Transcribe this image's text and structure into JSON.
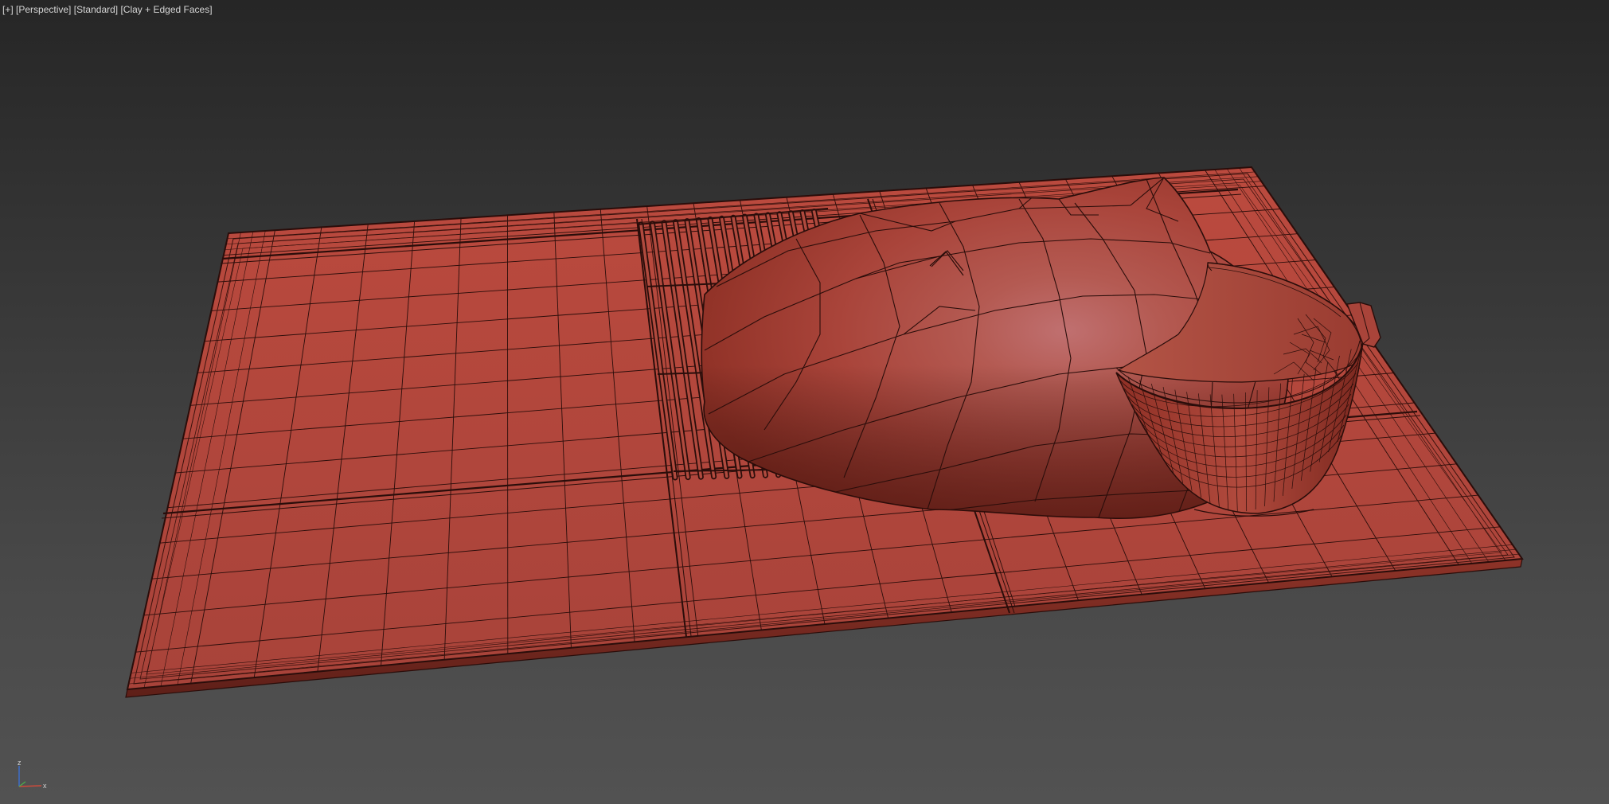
{
  "viewport": {
    "labels": {
      "maximize": "[+]",
      "view": "[Perspective]",
      "shading_preset": "[Standard]",
      "display_mode": "[Clay + Edged Faces]"
    },
    "axis": {
      "z": "z",
      "x": "x"
    }
  },
  "colors": {
    "background_top": "#262626",
    "background_bottom": "#525252",
    "clay": "#b5493d",
    "edge": "#2a0d0a",
    "label_text": "#d6d6d6",
    "axis_z": "#3d6fd1",
    "axis_x": "#d24a3a"
  }
}
